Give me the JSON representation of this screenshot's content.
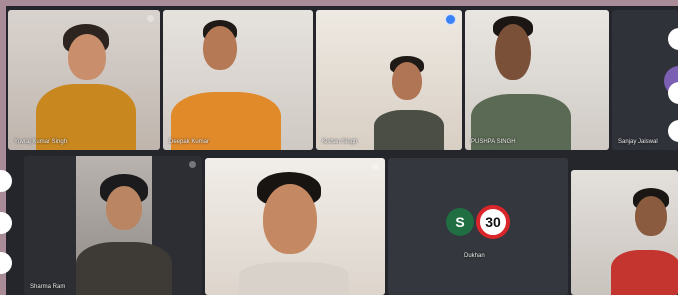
{
  "participants": [
    {
      "name": "Yuvraj Kumar Singh"
    },
    {
      "name": "Deepak Kumar"
    },
    {
      "name": "Kishan Singh"
    },
    {
      "name": "PUSHPA SINGH"
    },
    {
      "name": "Sanjay Jaiswal"
    },
    {
      "name": "Sharma Ram"
    },
    {
      "name": ""
    },
    {
      "name": "Dukhan",
      "avatar_letter": "S",
      "badge_text": "30"
    },
    {
      "name": ""
    }
  ],
  "colors": {
    "page_border": "#a98c98",
    "grid_bg": "#24262b",
    "avatar_green": "#1f6f43",
    "speed_sign_red": "#d8262a"
  }
}
